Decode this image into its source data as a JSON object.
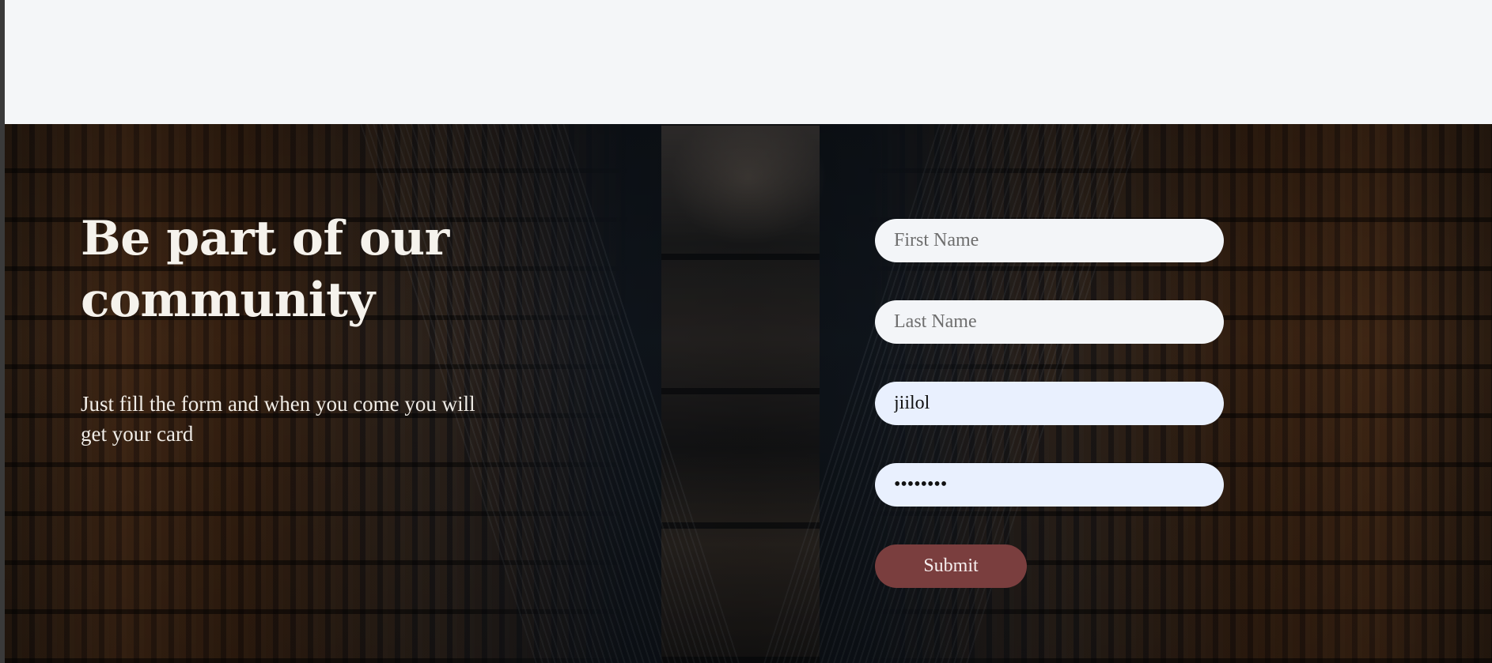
{
  "hero": {
    "heading": "Be part of our community",
    "subtext": "Just fill the form and when you come you will get your card"
  },
  "form": {
    "first_name_placeholder": "First Name",
    "last_name_placeholder": "Last Name",
    "username_value": "jiilol",
    "password_value": "••••••••",
    "submit_label": "Submit"
  },
  "colors": {
    "submit_button": "#7a3e3e",
    "empty_field": "#f3f5f8",
    "filled_field": "#e9f0fe",
    "top_bar": "#f4f6f8"
  }
}
